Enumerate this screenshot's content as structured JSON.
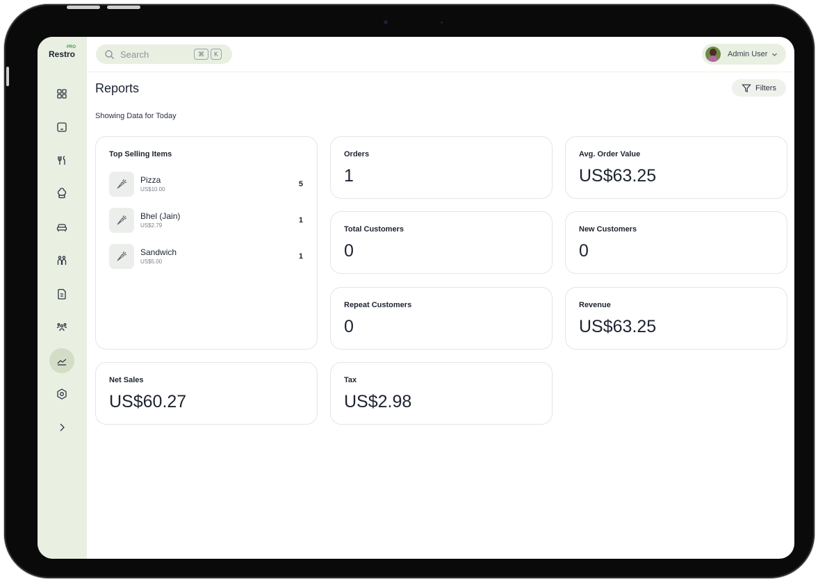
{
  "app": {
    "logo": "Restro",
    "logo_badge": "PRO"
  },
  "search": {
    "placeholder": "Search",
    "shortcut_cmd": "⌘",
    "shortcut_key": "K"
  },
  "user": {
    "name": "Admin User"
  },
  "page": {
    "title": "Reports",
    "subtitle": "Showing Data for Today",
    "filters_label": "Filters"
  },
  "sidebar": {
    "items": [
      {
        "icon": "dashboard-icon"
      },
      {
        "icon": "tablet-icon"
      },
      {
        "icon": "fork-knife-icon"
      },
      {
        "icon": "chef-hat-icon"
      },
      {
        "icon": "sofa-icon"
      },
      {
        "icon": "people-icon"
      },
      {
        "icon": "invoice-icon"
      },
      {
        "icon": "staff-icon"
      },
      {
        "icon": "reports-icon",
        "active": true
      },
      {
        "icon": "settings-icon"
      },
      {
        "icon": "chevron-right-icon"
      }
    ]
  },
  "top_selling": {
    "label": "Top Selling Items",
    "items": [
      {
        "name": "Pizza",
        "price": "US$10.00",
        "qty": "5"
      },
      {
        "name": "Bhel (Jain)",
        "price": "US$2.79",
        "qty": "1"
      },
      {
        "name": "Sandwich",
        "price": "US$5.00",
        "qty": "1"
      }
    ]
  },
  "stats": {
    "orders": {
      "label": "Orders",
      "value": "1"
    },
    "avg_order_value": {
      "label": "Avg. Order Value",
      "value": "US$63.25"
    },
    "total_customers": {
      "label": "Total Customers",
      "value": "0"
    },
    "new_customers": {
      "label": "New Customers",
      "value": "0"
    },
    "repeat_customers": {
      "label": "Repeat Customers",
      "value": "0"
    },
    "revenue": {
      "label": "Revenue",
      "value": "US$63.25"
    },
    "net_sales": {
      "label": "Net Sales",
      "value": "US$60.27"
    },
    "tax": {
      "label": "Tax",
      "value": "US$2.98"
    }
  },
  "colors": {
    "sidebar_bg": "#e9efe1",
    "active_nav": "#d3ddc6",
    "brand_badge": "#3aa04a"
  }
}
